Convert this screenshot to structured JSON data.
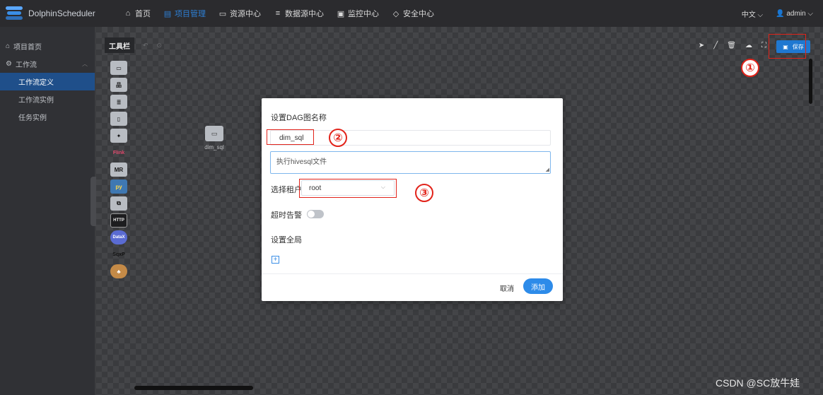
{
  "app": {
    "name": "DolphinScheduler"
  },
  "nav": {
    "items": [
      {
        "label": "首页",
        "icon": "home-icon",
        "active": false
      },
      {
        "label": "项目管理",
        "icon": "project-icon",
        "active": true
      },
      {
        "label": "资源中心",
        "icon": "folder-icon",
        "active": false
      },
      {
        "label": "数据源中心",
        "icon": "database-icon",
        "active": false
      },
      {
        "label": "监控中心",
        "icon": "monitor-icon",
        "active": false
      },
      {
        "label": "安全中心",
        "icon": "shield-icon",
        "active": false
      }
    ],
    "language": "中文",
    "user": "admin"
  },
  "sidebar": {
    "items": [
      {
        "label": "项目首页",
        "icon": "home-icon"
      },
      {
        "label": "工作流",
        "icon": "gear-icon"
      },
      {
        "label": "工作流定义",
        "active": true
      },
      {
        "label": "工作流实例"
      },
      {
        "label": "任务实例"
      }
    ]
  },
  "canvas": {
    "toolbox_label": "工具栏",
    "palette": [
      "SHELL",
      "SUB_PROCESS",
      "PROCEDURE",
      "SQL",
      "SPARK",
      "FLINK",
      "MR",
      "PYTHON",
      "DEPENDENT",
      "HTTP",
      "DATAX",
      "SQOOP",
      "CONDITIONS"
    ],
    "node": {
      "label": "dim_sql"
    },
    "save_label": "保存"
  },
  "modal": {
    "title": "设置DAG图名称",
    "name_value": "dim_sql",
    "description_value": "执行hivesql文件",
    "tenant_label": "选择租户",
    "tenant_value": "root",
    "timeout_label": "超时告警",
    "timeout_enabled": false,
    "global_label": "设置全局",
    "cancel_label": "取消",
    "confirm_label": "添加"
  },
  "annotations": [
    "①",
    "②",
    "③"
  ],
  "watermark": "CSDN @SC放牛娃"
}
